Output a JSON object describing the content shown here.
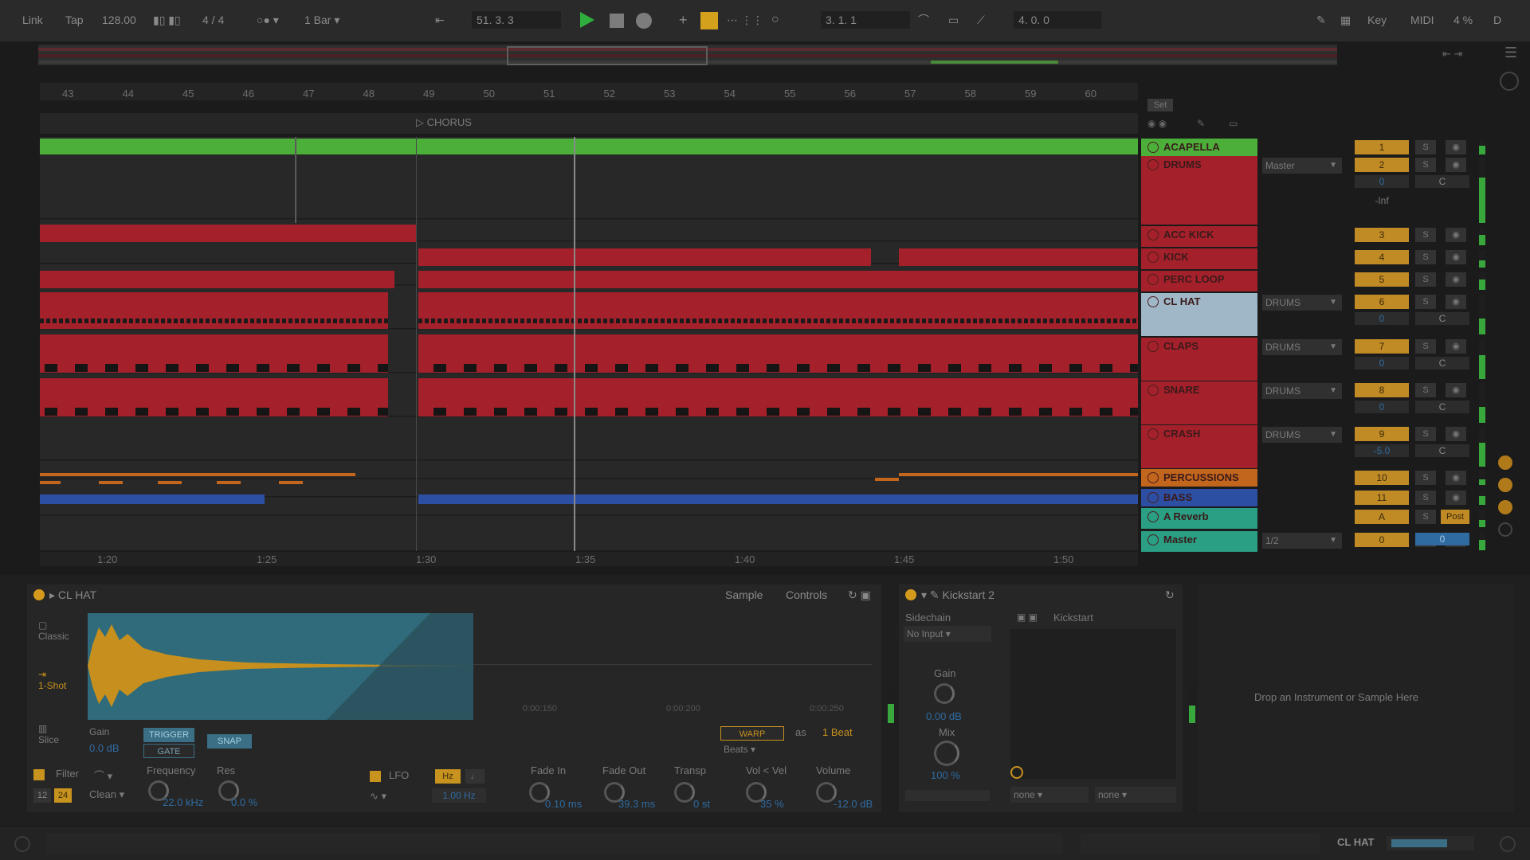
{
  "transport": {
    "link": "Link",
    "tap": "Tap",
    "tempo": "128.00",
    "time_signature": "4 / 4",
    "quantize": "1 Bar",
    "position": "51.  3.  3",
    "loop_start": "3.  1.  1",
    "loop_length": "4.  0.  0",
    "key": "Key",
    "midi": "MIDI",
    "cpu": "4 %",
    "disk": "D"
  },
  "ruler": {
    "bars": [
      "43",
      "44",
      "45",
      "46",
      "47",
      "48",
      "49",
      "50",
      "51",
      "52",
      "53",
      "54",
      "55",
      "56",
      "57",
      "58",
      "59",
      "60"
    ]
  },
  "locators": {
    "chorus": "CHORUS"
  },
  "timeline": {
    "times": [
      "1:20",
      "1:25",
      "1:30",
      "1:35",
      "1:40",
      "1:45",
      "1:50"
    ]
  },
  "header_tools": {
    "set": "Set"
  },
  "tracks": [
    {
      "name": "ACAPELLA",
      "number": "1",
      "color": "#4caf3a"
    },
    {
      "name": "DRUMS",
      "number": "2",
      "route": "Master",
      "volume": "0",
      "pan": "C",
      "db": "-Inf",
      "color": "#a4202a"
    },
    {
      "name": "ACC KICK",
      "number": "3",
      "color": "#a4202a"
    },
    {
      "name": "KICK",
      "number": "4",
      "color": "#a4202a"
    },
    {
      "name": "PERC LOOP",
      "number": "5",
      "color": "#a4202a"
    },
    {
      "name": "CL HAT",
      "number": "6",
      "route": "DRUMS",
      "volume": "0",
      "pan": "C",
      "color": "#9fb7c6"
    },
    {
      "name": "CLAPS",
      "number": "7",
      "route": "DRUMS",
      "volume": "0",
      "pan": "C",
      "color": "#a4202a"
    },
    {
      "name": "SNARE",
      "number": "8",
      "route": "DRUMS",
      "volume": "0",
      "pan": "C",
      "color": "#a4202a"
    },
    {
      "name": "CRASH",
      "number": "9",
      "route": "DRUMS",
      "volume": "-5.0",
      "pan": "C",
      "color": "#a4202a"
    },
    {
      "name": "PERCUSSIONS",
      "number": "10",
      "color": "#c2651d"
    },
    {
      "name": "BASS",
      "number": "11",
      "color": "#2d4fa3"
    },
    {
      "name": "A Reverb",
      "number": "A",
      "post": "Post",
      "color": "#2a9f84"
    },
    {
      "name": "Master",
      "number": "0",
      "route": "1/2",
      "volume": "0",
      "color": "#2a9f84"
    }
  ],
  "device_clip": {
    "title": "CL HAT",
    "tab_sample": "Sample",
    "tab_controls": "Controls",
    "mode_classic": "Classic",
    "mode_oneshot": "1-Shot",
    "mode_slice": "Slice",
    "gain_label": "Gain",
    "gain_value": "0.0 dB",
    "trigger": "TRIGGER",
    "gate": "GATE",
    "snap": "SNAP",
    "warp": "WARP",
    "as": "as",
    "beat": "1 Beat",
    "beats": "Beats",
    "filter": "Filter",
    "filter_type": "Clean",
    "f12": "12",
    "f24": "24",
    "frequency_label": "Frequency",
    "frequency_value": "22.0 kHz",
    "res_label": "Res",
    "res_value": "0.0 %",
    "lfo": "LFO",
    "lfo_hz": "Hz",
    "lfo_rate": "1.00 Hz",
    "fade_in_label": "Fade In",
    "fade_in_value": "0.10 ms",
    "fade_out_label": "Fade Out",
    "fade_out_value": "39.3 ms",
    "transp_label": "Transp",
    "transp_value": "0 st",
    "vel_label": "Vol < Vel",
    "vel_value": "35 %",
    "volume_label": "Volume",
    "volume_value": "-12.0 dB",
    "t1": "0:00:150",
    "t2": "0:00:200",
    "t3": "0:00:250"
  },
  "device_kick": {
    "title": "Kickstart 2",
    "sidechain": "Sidechain",
    "input": "No Input",
    "gain_label": "Gain",
    "gain_value": "0.00 dB",
    "mix_label": "Mix",
    "mix_value": "100 %",
    "preset": "Kickstart",
    "none1": "none",
    "none2": "none"
  },
  "drop_zone": "Drop an Instrument or Sample Here",
  "status": {
    "selected": "CL HAT"
  }
}
